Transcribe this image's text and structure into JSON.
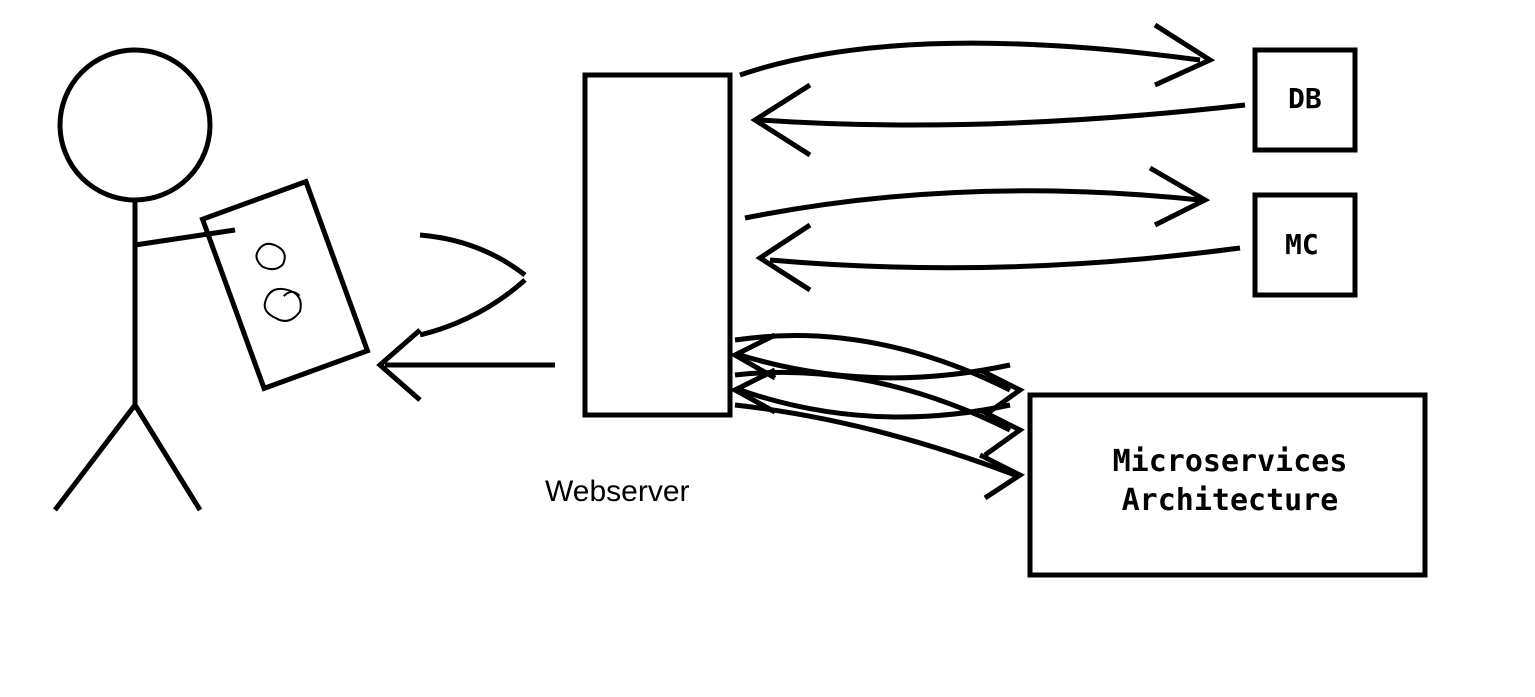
{
  "nodes": {
    "user": {
      "type": "stick-figure-with-phone"
    },
    "webserver": {
      "label": "Webserver"
    },
    "db": {
      "label": "DB"
    },
    "mc": {
      "label": "MC"
    },
    "microservices": {
      "label": "Microservices\nArchitecture"
    }
  },
  "edges": [
    {
      "from": "user",
      "to": "webserver",
      "bidirectional": true
    },
    {
      "from": "webserver",
      "to": "db",
      "bidirectional": true
    },
    {
      "from": "webserver",
      "to": "mc",
      "bidirectional": true
    },
    {
      "from": "webserver",
      "to": "microservices",
      "bidirectional": true,
      "multiple": true
    }
  ]
}
